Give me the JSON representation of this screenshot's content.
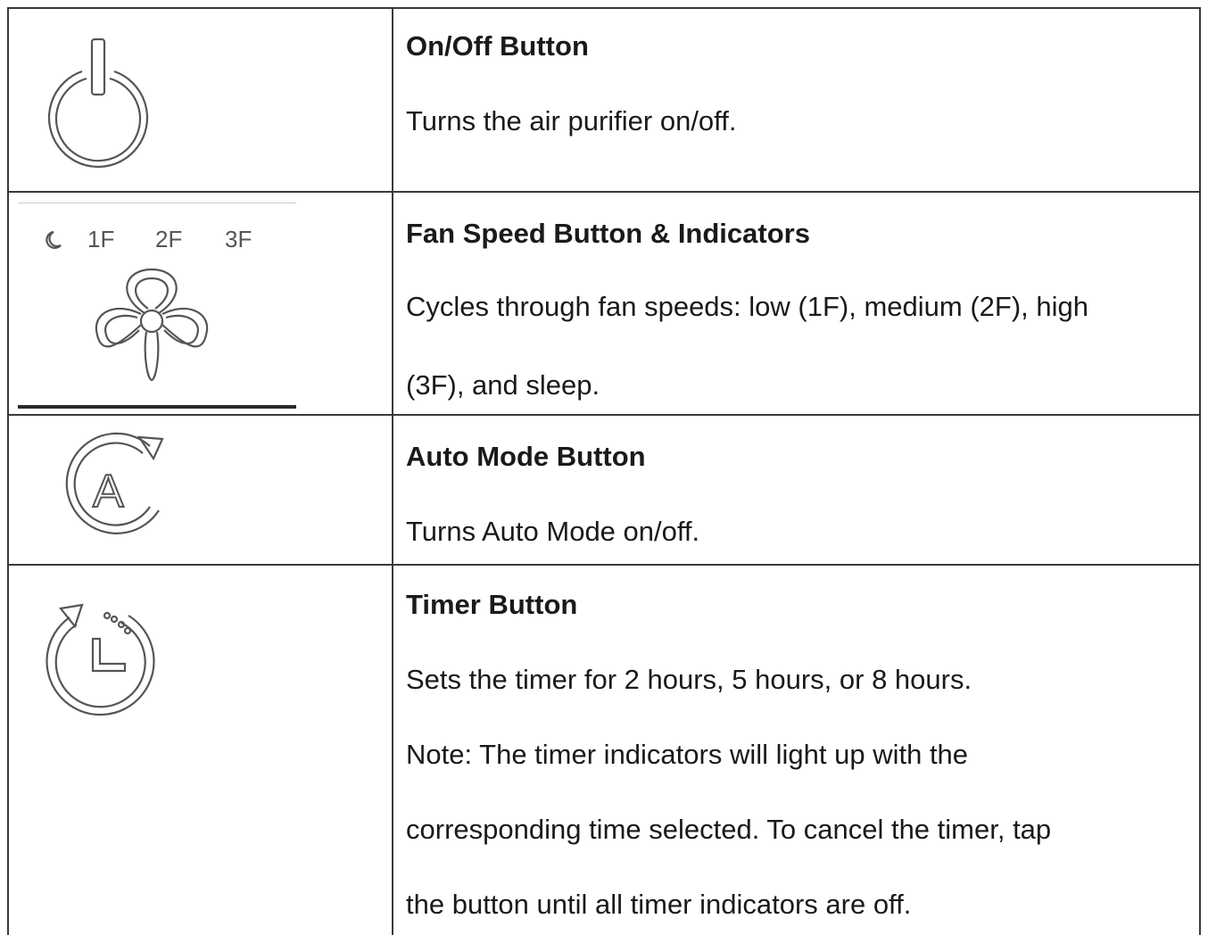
{
  "rows": [
    {
      "icon": "power-icon",
      "title": "On/Off Button",
      "lines": [
        "Turns the air purifier on/off."
      ]
    },
    {
      "icon": "fan-icon",
      "icon_labels": [
        "1F",
        "2F",
        "3F"
      ],
      "title": "Fan Speed Button & Indicators",
      "lines": [
        "Cycles through fan speeds: low (1F), medium (2F), high",
        "(3F), and sleep."
      ]
    },
    {
      "icon": "auto-mode-icon",
      "icon_text": "A",
      "title": "Auto Mode Button",
      "lines": [
        "Turns Auto Mode on/off."
      ]
    },
    {
      "icon": "timer-icon",
      "title": "Timer Button",
      "lines": [
        "Sets the timer for 2 hours, 5 hours, or 8 hours.",
        "Note: The timer indicators will light up with the",
        "corresponding time selected. To cancel the timer, tap",
        "the button until all timer indicators are off."
      ]
    }
  ]
}
